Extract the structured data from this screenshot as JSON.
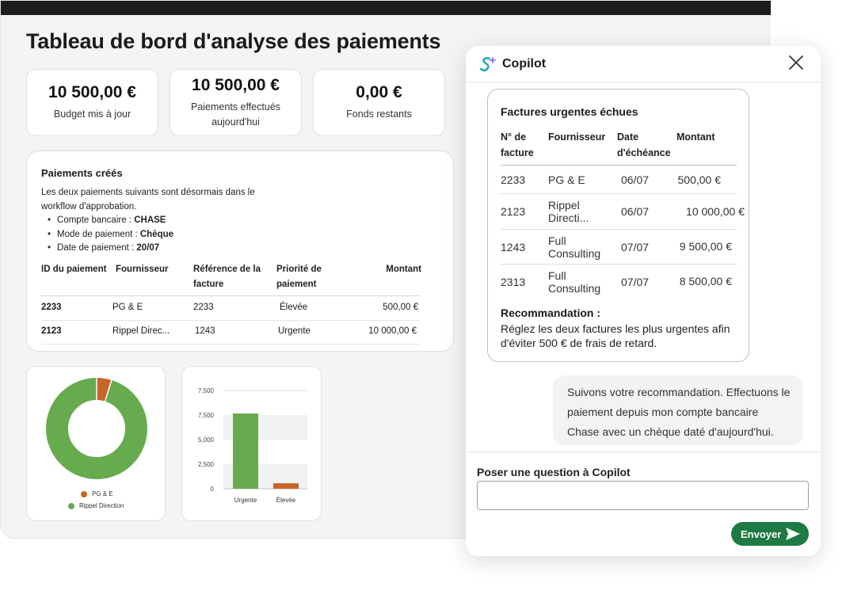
{
  "page_title": "Tableau de bord d'analyse des paiements",
  "stats": [
    {
      "amount": "10 500,00 €",
      "label": "Budget mis à jour"
    },
    {
      "amount": "10 500,00 €",
      "label": "Paiements effectués aujourd'hui"
    },
    {
      "amount": "0,00 €",
      "label": "Fonds restants"
    }
  ],
  "payments": {
    "title": "Paiements créés",
    "description": "Les deux paiements suivants sont désormais dans le workflow d'approbation.",
    "bullets": [
      {
        "label": "Compte bancaire : ",
        "value": "CHASE"
      },
      {
        "label": "Mode de paiement : ",
        "value": "Chèque"
      },
      {
        "label": "Date de paiement : ",
        "value": "20/07"
      }
    ],
    "columns": [
      "ID du paiement",
      "Fournisseur",
      "Référence de la facture",
      "Priorité de paiement",
      "Montant"
    ],
    "rows": [
      {
        "id": "2233",
        "supplier": "PG & E",
        "ref": "2233",
        "priority": "Élevée",
        "amount": "500,00 €"
      },
      {
        "id": "2123",
        "supplier": "Rippel Direc...",
        "ref": "1243",
        "priority": "Urgente",
        "amount": "10 000,00 €"
      }
    ]
  },
  "colors": {
    "green": "#67ab4f",
    "orange": "#c8652a",
    "brand_button": "#1e7a42"
  },
  "chart_data": [
    {
      "type": "pie",
      "categories": [
        "PG & E",
        "Rippel Direction"
      ],
      "values": [
        500,
        10000
      ],
      "legend_placement": "bottom"
    },
    {
      "type": "bar",
      "categories": [
        "Urgente",
        "Élevée"
      ],
      "values": [
        6900,
        500
      ],
      "ytick_labels": [
        "7,500",
        "7,500",
        "5,000",
        "2,500",
        "0"
      ],
      "ylim": [
        0,
        9000
      ],
      "grid": "alternating-bands"
    }
  ],
  "copilot": {
    "title": "Copilot",
    "logo_icon": "copilot-s-sparkle-icon",
    "invoices": {
      "title": "Factures urgentes échues",
      "columns": [
        "N° de facture",
        "Fournisseur",
        "Date d'échéance",
        "Montant"
      ],
      "rows": [
        {
          "num": "2233",
          "supplier": "PG & E",
          "due": "06/07",
          "amount": "500,00 €"
        },
        {
          "num": "2123",
          "supplier": "Rippel Directi...",
          "due": "06/07",
          "amount": "10 000,00 €"
        },
        {
          "num": "1243",
          "supplier": "Full Consulting",
          "due": "07/07",
          "amount": "9 500,00 €"
        },
        {
          "num": "2313",
          "supplier": "Full Consulting",
          "due": "07/07",
          "amount": "8 500,00 €"
        }
      ],
      "recommendation_title": "Recommandation :",
      "recommendation_text": "Réglez les deux factures les plus urgentes afin d'éviter 500 € de frais de retard."
    },
    "user_message": "Suivons votre recommandation. Effectuons le paiement depuis mon compte bancaire Chase avec un chèque daté d'aujourd'hui.",
    "ask_label": "Poser une question à Copilot",
    "input_value": "",
    "send_label": "Envoyer"
  }
}
